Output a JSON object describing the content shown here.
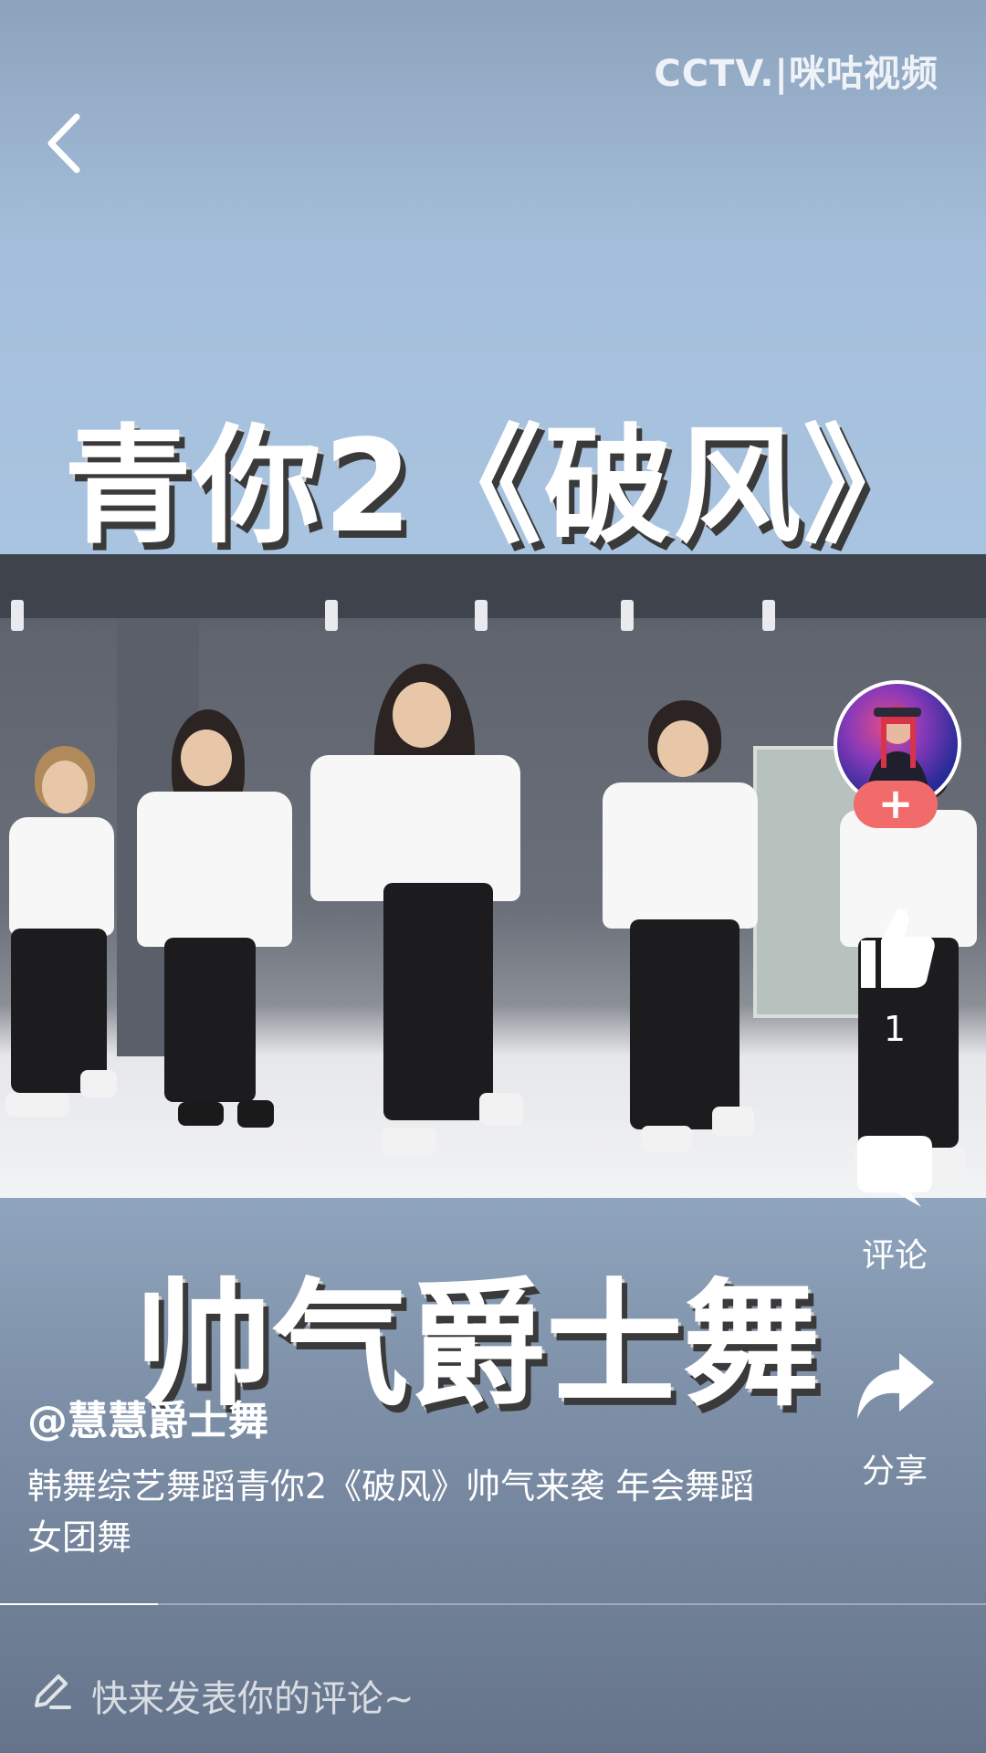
{
  "watermark": "CCTV.|咪咕视频",
  "video": {
    "title_top": "青你2《破风》",
    "title_bottom": "帅气爵士舞",
    "progress_fraction": 0.16
  },
  "author": {
    "handle": "@慧慧爵士舞"
  },
  "description": "韩舞综艺舞蹈青你2《破风》帅气来袭 年会舞蹈女团舞",
  "actions": {
    "follow_symbol": "+",
    "like_count": "1",
    "comment_label": "评论",
    "share_label": "分享"
  },
  "comment_input": {
    "placeholder": "快来发表你的评论~"
  },
  "icons": {
    "back": "chevron-left-icon",
    "like": "thumbs-up-icon",
    "comment": "speech-bubble-icon",
    "share": "share-arrow-icon",
    "edit": "pencil-icon"
  },
  "colors": {
    "follow_button": "#f26b6b",
    "text": "#ffffff"
  }
}
